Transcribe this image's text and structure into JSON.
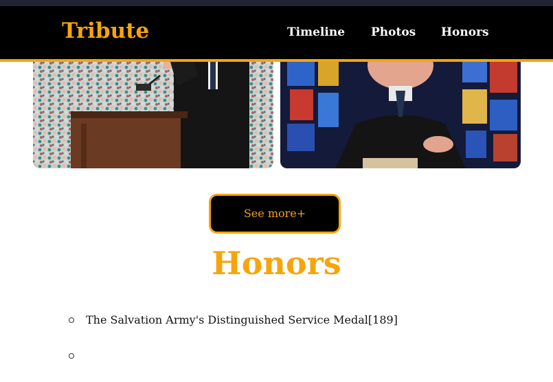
{
  "header": {
    "brand": "Tribute",
    "nav": [
      "Timeline",
      "Photos",
      "Honors"
    ]
  },
  "gallery": {
    "see_more_label": "See more+"
  },
  "honors": {
    "title": "Honors",
    "items": [
      "The Salvation Army's Distinguished Service Medal[189]",
      ""
    ]
  },
  "colors": {
    "accent": "#f5a50b",
    "navbar_bg": "#000000",
    "top_strip": "#232336"
  },
  "icons": {
    "bullet": "hollow-circle-bullet-icon"
  }
}
